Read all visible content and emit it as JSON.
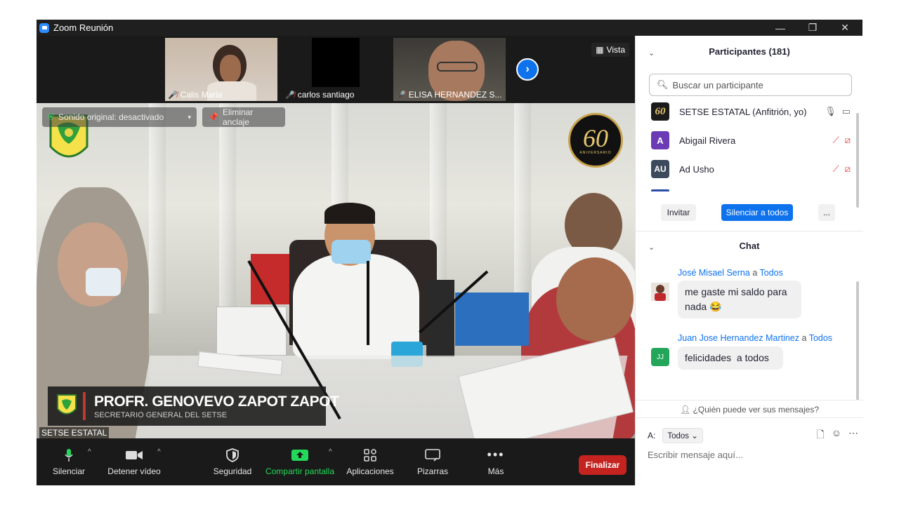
{
  "window": {
    "title": "Zoom Reunión",
    "controls": [
      "—",
      "❐",
      "✕"
    ]
  },
  "thumbnails": [
    {
      "name": "Calis Maria",
      "muted": true
    },
    {
      "name": "carlos santiago",
      "muted": true
    },
    {
      "name": "ELISA HERNANDEZ S...",
      "muted": true
    }
  ],
  "view_button": "Vista",
  "overlay": {
    "audio_pill": "Sonido original: desactivado",
    "unpin_pill": "Eliminar anclaje",
    "anniversary_logo": "60",
    "anniversary_sub": "ANIVERSARIO"
  },
  "lower_third": {
    "name": "PROFR. GENOVEVO ZAPOT ZAPOT",
    "role": "SECRETARIO GENERAL DEL SETSE"
  },
  "speaker_label": "SETSE ESTATAL",
  "toolbar": {
    "mute": "Silenciar",
    "video": "Detener vídeo",
    "security": "Seguridad",
    "share": "Compartir pantalla",
    "apps": "Aplicaciones",
    "whiteboards": "Pizarras",
    "more": "Más",
    "end": "Finalizar"
  },
  "participants": {
    "title": "Participantes (181)",
    "search_placeholder": "Buscar un participante",
    "list": [
      {
        "name": "SETSE ESTATAL (Anfitrión, yo)",
        "avatar_text": "60",
        "avatar_color": "#1b1b1b"
      },
      {
        "name": "Abigail Rivera",
        "avatar_text": "A",
        "avatar_color": "#6a3bb5"
      },
      {
        "name": "Ad Usho",
        "avatar_text": "AU",
        "avatar_color": "#3d4a5c"
      }
    ],
    "invite": "Invitar",
    "mute_all": "Silenciar a todos",
    "more": "..."
  },
  "chat": {
    "title": "Chat",
    "messages": [
      {
        "sender": "José Misael Serna",
        "to_word": "a",
        "to": "Todos",
        "lines": [
          "me gaste mi saldo para",
          "nada"
        ],
        "emoji": "😂"
      },
      {
        "sender": "Juan Jose Hernandez Martinez",
        "to_word": "a",
        "to": "Todos",
        "lines": [
          "felicidades  a todos"
        ],
        "avatar_text": "JJ",
        "avatar_color": "#23a55a"
      }
    ],
    "who_can_see": "¿Quién puede ver sus mensajes?",
    "to_label": "A:",
    "to_value": "Todos",
    "compose_placeholder": "Escribir mensaje aquí..."
  },
  "colors": {
    "accent": "#0e72ed",
    "end_red": "#c4231f",
    "share_green": "#23d959"
  }
}
